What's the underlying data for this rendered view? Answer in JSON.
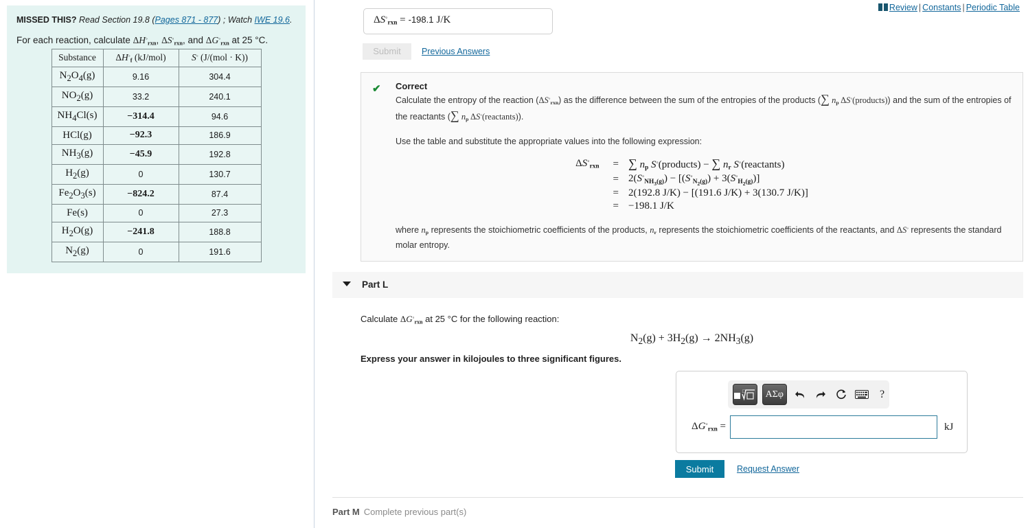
{
  "left_panel": {
    "hint": {
      "prefix": "MISSED THIS?",
      "read_text": "Read Section 19.8",
      "pages_link": "Pages 871 - 877",
      "separator": " ; ",
      "watch_text": "Watch",
      "iwe_link": "IWE 19.6",
      "trailing": "."
    },
    "prompt": {
      "before": "For each reaction, calculate ",
      "term1": "ΔH°rxn",
      "mid1": ", ",
      "term2": "ΔS°rxn",
      "mid2": ", and ",
      "term3": "ΔG°rxn",
      "after": " at 25 °C."
    },
    "table": {
      "headers": [
        "Substance",
        "ΔH°f  (kJ/mol)",
        "S°  (J/(mol · K))"
      ],
      "rows": [
        {
          "substance": "N2O4(g)",
          "dHf": "9.16",
          "S": "304.4"
        },
        {
          "substance": "NO2(g)",
          "dHf": "33.2",
          "S": "240.1"
        },
        {
          "substance": "NH4Cl(s)",
          "dHf": "−314.4",
          "S": "94.6"
        },
        {
          "substance": "HCl(g)",
          "dHf": "−92.3",
          "S": "186.9"
        },
        {
          "substance": "NH3(g)",
          "dHf": "−45.9",
          "S": "192.8"
        },
        {
          "substance": "H2(g)",
          "dHf": "0",
          "S": "130.7"
        },
        {
          "substance": "Fe2O3(s)",
          "dHf": "−824.2",
          "S": "87.4"
        },
        {
          "substance": "Fe(s)",
          "dHf": "0",
          "S": "27.3"
        },
        {
          "substance": "H2O(g)",
          "dHf": "−241.8",
          "S": "188.8"
        },
        {
          "substance": "N2(g)",
          "dHf": "0",
          "S": "191.6"
        }
      ]
    }
  },
  "right_panel": {
    "top_links": {
      "review": "Review",
      "constants": "Constants",
      "periodic_table": "Periodic Table",
      "separator": "|"
    },
    "previous_part": {
      "label": "ΔS°rxn",
      "equals": "=",
      "value": "-198.1",
      "unit": "J/K",
      "submit_label": "Submit",
      "previous_answers_label": "Previous Answers"
    },
    "feedback": {
      "status": "Correct",
      "check_glyph": "✔",
      "paragraph1_a": "Calculate the entropy of the reaction (",
      "paragraph1_b": ") as the difference between the sum of the entropies of the products (",
      "paragraph1_c": ") and the sum of the entropies of the reactants (",
      "paragraph1_d": ").",
      "paragraph2": "Use the table and substitute the appropriate values into the following expression:",
      "equation": {
        "lhs": "ΔS°rxn",
        "lines": [
          {
            "rel": "=",
            "rhs": "∑ np S°(products) − ∑ nr S°(reactants)"
          },
          {
            "rel": "=",
            "rhs": "2(S°NH3(g)) − [(S°N2(g)) + 3(S°H2(g))]"
          },
          {
            "rel": "=",
            "rhs": "2(192.8 J/K) − [(191.6 J/K) + 3(130.7 J/K)]"
          },
          {
            "rel": "=",
            "rhs": "−198.1 J/K"
          }
        ]
      },
      "where_a": "where ",
      "where_b": " represents the stoichiometric coefficients of the products, ",
      "where_c": " represents the stoichiometric coefficients of the reactants, and ",
      "where_d": " represents the standard molar entropy."
    },
    "part_l": {
      "title": "Part L",
      "caret": "caret-down",
      "question_before": "Calculate ",
      "question_term": "ΔG°rxn",
      "question_after": " at 25 °C for the following reaction:",
      "reaction": "N2(g) + 3H2(g) → 2NH3(g)",
      "instruction": "Express your answer in kilojoules to three significant figures.",
      "toolbar": {
        "template_button": "■√□",
        "symbols_button": "ΑΣφ",
        "undo": "undo-arrow",
        "redo": "redo-arrow",
        "reset": "reset-circle",
        "keyboard": "keyboard",
        "help": "?"
      },
      "answer_label": "ΔG°rxn",
      "answer_equals": "=",
      "answer_value": "",
      "answer_placeholder": "",
      "answer_unit": "kJ",
      "submit_label": "Submit",
      "request_answer_label": "Request Answer"
    },
    "part_m": {
      "title": "Part M",
      "status": "Complete previous part(s)"
    }
  },
  "colors": {
    "accent_link": "#12679b",
    "submit_active": "#0b7ba0",
    "hint_bg": "#e4f4f2",
    "correct_green": "#1a8a33",
    "input_border": "#2c7b9b"
  }
}
